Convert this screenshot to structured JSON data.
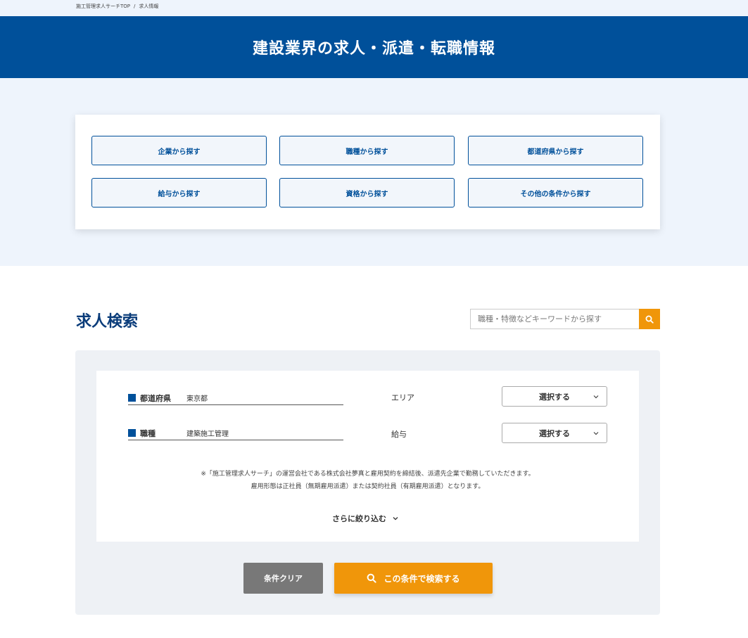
{
  "breadcrumb": {
    "home": "施工管理求人サーチTOP",
    "separator": "/",
    "current": "求人情報"
  },
  "hero": {
    "title": "建設業界の求人・派遣・転職情報"
  },
  "categories": [
    {
      "label": "企業から探す"
    },
    {
      "label": "職種から探す"
    },
    {
      "label": "都道府県から探す"
    },
    {
      "label": "給与から探す"
    },
    {
      "label": "資格から探す"
    },
    {
      "label": "その他の条件から探す"
    }
  ],
  "search": {
    "title": "求人検索",
    "keyword_placeholder": "職種・特徴などキーワードから探す",
    "prefecture": {
      "label": "都道府県",
      "value": "東京都"
    },
    "job_type": {
      "label": "職種",
      "value": "建築施工管理"
    },
    "area": {
      "label": "エリア",
      "select": "選択する"
    },
    "salary": {
      "label": "給与",
      "select": "選択する"
    },
    "note_line1": "※「施工管理求人サーチ」の運営会社である株式会社夢真と雇用契約を締結後、派遣先企業で勤務していただきます。",
    "note_line2": "雇用形態は正社員（無期雇用派遣）または契約社員（有期雇用派遣）となります。",
    "more_label": "さらに絞り込む",
    "clear_label": "条件クリア",
    "submit_label": "この条件で検索する"
  },
  "colors": {
    "brand": "#00509a",
    "accent": "#f0960a",
    "band": "#eef4fc"
  }
}
